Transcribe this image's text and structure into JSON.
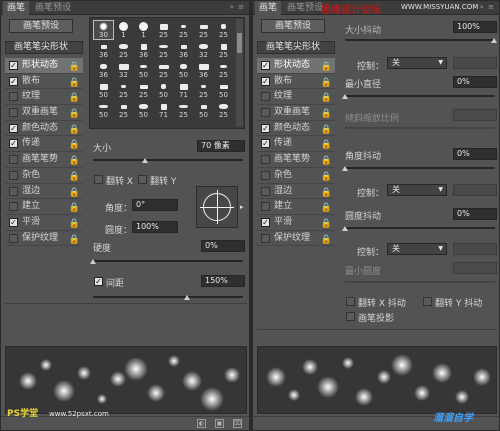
{
  "left_panel": {
    "tabs": [
      "画笔",
      "画笔预设"
    ],
    "preset_button": "画笔预设",
    "nav_header": "画笔笔尖形状",
    "nav_items": [
      {
        "label": "形状动态",
        "checked": true
      },
      {
        "label": "散布",
        "checked": true
      },
      {
        "label": "纹理",
        "checked": false
      },
      {
        "label": "双重画笔",
        "checked": false
      },
      {
        "label": "颜色动态",
        "checked": true
      },
      {
        "label": "传递",
        "checked": true
      },
      {
        "label": "画笔笔势",
        "checked": false
      },
      {
        "label": "杂色",
        "checked": false
      },
      {
        "label": "湿边",
        "checked": false
      },
      {
        "label": "建立",
        "checked": false
      },
      {
        "label": "平滑",
        "checked": true
      },
      {
        "label": "保护纹理",
        "checked": false
      }
    ],
    "brush_sizes": [
      [
        "30",
        "1",
        "1",
        "25",
        "25",
        "25",
        "25"
      ],
      [
        "36",
        "25",
        "36",
        "25",
        "36",
        "32",
        "25"
      ],
      [
        "36",
        "32",
        "50",
        "25",
        "50",
        "36",
        "25"
      ],
      [
        "50",
        "25",
        "25",
        "50",
        "71",
        "25",
        "50"
      ],
      [
        "50",
        "25",
        "50",
        "71",
        "25",
        "50",
        "25"
      ]
    ],
    "size_label": "大小",
    "size_value": "70 像素",
    "flip_x_label": "翻转 X",
    "flip_y_label": "翻转 Y",
    "angle_label": "角度：",
    "angle_value": "0°",
    "roundness_label": "圆度：",
    "roundness_value": "100%",
    "hardness_label": "硬度",
    "hardness_value": "0%",
    "spacing_label": "间距",
    "spacing_value": "150%"
  },
  "right_panel": {
    "tabs": [
      "画笔",
      "画笔预设"
    ],
    "preset_button": "画笔预设",
    "nav_header": "画笔笔尖形状",
    "nav_items": [
      {
        "label": "形状动态",
        "checked": true
      },
      {
        "label": "散布",
        "checked": true
      },
      {
        "label": "纹理",
        "checked": false
      },
      {
        "label": "双重画笔",
        "checked": false
      },
      {
        "label": "颜色动态",
        "checked": true
      },
      {
        "label": "传递",
        "checked": true
      },
      {
        "label": "画笔笔势",
        "checked": false
      },
      {
        "label": "杂色",
        "checked": false
      },
      {
        "label": "湿边",
        "checked": false
      },
      {
        "label": "建立",
        "checked": false
      },
      {
        "label": "平滑",
        "checked": true
      },
      {
        "label": "保护纹理",
        "checked": false
      }
    ],
    "size_jitter_label": "大小抖动",
    "size_jitter_value": "100%",
    "control_label": "控制：",
    "control_value_1": "关",
    "min_diameter_label": "最小直径",
    "min_diameter_value": "0%",
    "tilt_scale_label": "倾斜缩放比例",
    "angle_jitter_label": "角度抖动",
    "angle_jitter_value": "0%",
    "control_value_2": "关",
    "roundness_jitter_label": "圆度抖动",
    "roundness_jitter_value": "0%",
    "control_value_3": "关",
    "min_roundness_label": "最小圆度",
    "flip_x_jitter_label": "翻转 X 抖动",
    "flip_y_jitter_label": "翻转 Y 抖动",
    "brush_projection_label": "画笔投影"
  },
  "watermarks": {
    "top": "思缘设计论坛",
    "top_url": "WWW.MISSYUAN.COM",
    "bottom_left": "PS学堂",
    "bottom_url": "www.52psxt.com",
    "bottom_right": "溜溜自学"
  }
}
